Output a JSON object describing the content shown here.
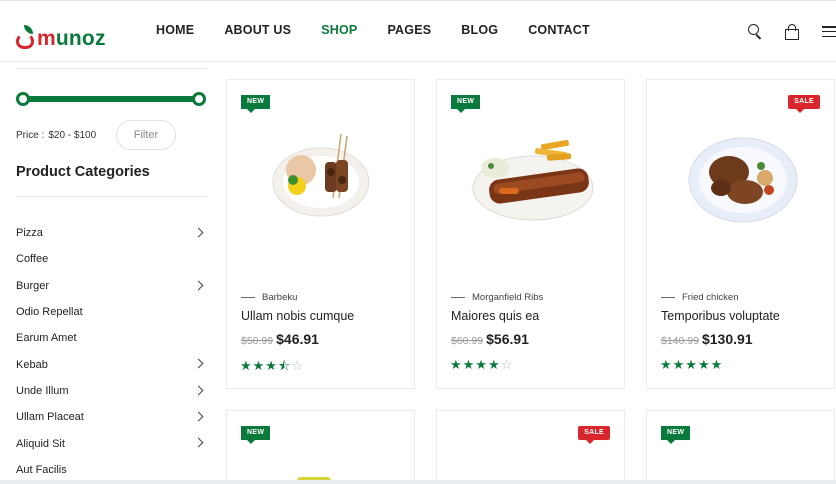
{
  "brand": {
    "name_prefix": "m",
    "name_rest": "unoz"
  },
  "nav": [
    {
      "label": "HOME",
      "active": false
    },
    {
      "label": "ABOUT US",
      "active": false
    },
    {
      "label": "SHOP",
      "active": true
    },
    {
      "label": "PAGES",
      "active": false
    },
    {
      "label": "BLOG",
      "active": false
    },
    {
      "label": "CONTACT",
      "active": false
    }
  ],
  "header_icons": [
    "search-icon",
    "cart-icon",
    "menu-icon"
  ],
  "sidebar": {
    "price_label": "Price :",
    "price_range": "$20 - $100",
    "filter_label": "Filter",
    "categories_title": "Product Categories",
    "categories": [
      {
        "label": "Pizza",
        "has_children": true
      },
      {
        "label": "Coffee",
        "has_children": false
      },
      {
        "label": "Burger",
        "has_children": true
      },
      {
        "label": "Odio Repellat",
        "has_children": false
      },
      {
        "label": "Earum Amet",
        "has_children": false
      },
      {
        "label": "Kebab",
        "has_children": true
      },
      {
        "label": "Unde Illum",
        "has_children": true
      },
      {
        "label": "Ullam Placeat",
        "has_children": true
      },
      {
        "label": "Aliquid Sit",
        "has_children": true
      },
      {
        "label": "Aut Facilis",
        "has_children": false
      }
    ]
  },
  "products": [
    {
      "badge": "NEW",
      "badge_type": "new",
      "category": "Barbeku",
      "title": "Ullam nobis cumque",
      "old_price": "$50.99",
      "price": "$46.91",
      "rating": 3.5,
      "image": "skewers-plate"
    },
    {
      "badge": "NEW",
      "badge_type": "new",
      "category": "Morganfield Ribs",
      "title": "Maiores quis ea",
      "old_price": "$60.99",
      "price": "$56.91",
      "rating": 4,
      "image": "ribs-plate"
    },
    {
      "badge": "SALE",
      "badge_type": "sale",
      "category": "Fried chicken",
      "title": "Temporibus voluptate",
      "old_price": "$140.99",
      "price": "$130.91",
      "rating": 5,
      "image": "chicken-plate"
    }
  ],
  "products_row2": [
    {
      "badge": "NEW",
      "badge_type": "new"
    },
    {
      "badge": "SALE",
      "badge_type": "sale"
    },
    {
      "badge": "NEW",
      "badge_type": "new"
    }
  ],
  "colors": {
    "brand_green": "#0a7a3c",
    "sale_red": "#d8262c"
  }
}
